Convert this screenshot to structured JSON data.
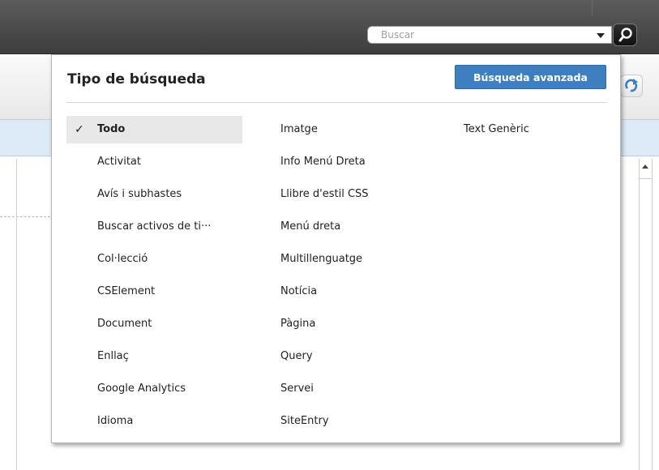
{
  "search": {
    "placeholder": "Buscar"
  },
  "panel": {
    "title": "Tipo de búsqueda",
    "advanced_label": "Búsqueda avanzada",
    "check_mark": "✓",
    "columns": [
      [
        "Todo",
        "Activitat",
        "Avís i subhastes",
        "Buscar activos de ti···",
        "Col·lecció",
        "CSElement",
        "Document",
        "Enllaç",
        "Google Analytics",
        "Idioma"
      ],
      [
        "Imatge",
        "Info Menú Dreta",
        "Llibre d'estil CSS",
        "Menú dreta",
        "Multillenguatge",
        "Notícia",
        "Pàgina",
        "Query",
        "Servei",
        "SiteEntry"
      ],
      [
        "Text Genèric"
      ]
    ],
    "selected": "Todo"
  },
  "icons": {
    "search_button": "search-icon",
    "dropdown": "chevron-down-icon",
    "refresh": "refresh-icon",
    "scroll_up": "scroll-up-arrow-icon"
  },
  "colors": {
    "accent": "#3d7fbf",
    "topbar": "#4a4a4a",
    "strip": "#dce9f6",
    "selected_row": "#e8e8e8"
  }
}
